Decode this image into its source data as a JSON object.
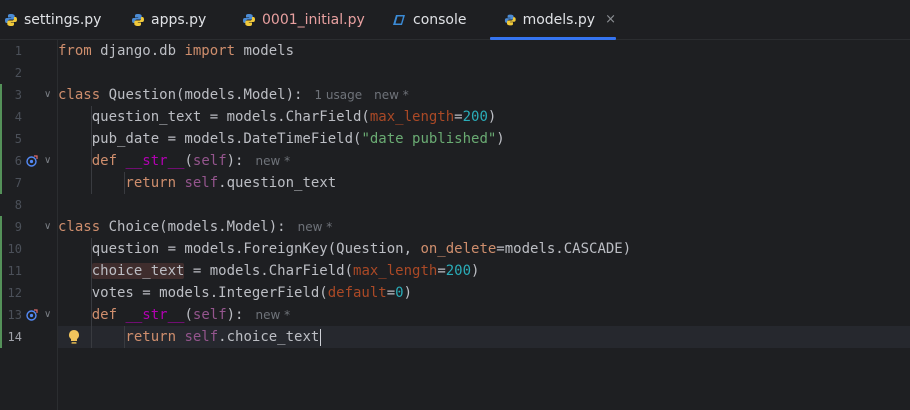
{
  "tabs": [
    {
      "label": "settings.py",
      "icon": "python-icon"
    },
    {
      "label": "apps.py",
      "icon": "python-icon"
    },
    {
      "label": "0001_initial.py",
      "icon": "python-icon"
    },
    {
      "label": "console",
      "icon": "console-icon"
    },
    {
      "label": "models.py",
      "icon": "python-icon",
      "active": true,
      "close": "×"
    }
  ],
  "hints": {
    "question_usage": "1 usage",
    "new": "new *"
  },
  "code": {
    "l1_from": "from",
    "l1_mod": " django.db ",
    "l1_import": "import",
    "l1_name": " models",
    "l3_class": "class",
    "l3_rest": " Question(models.Model):",
    "l4_a": "    question_text = models.CharField(",
    "l4_param": "max_length",
    "l4_eq": "=",
    "l4_num": "200",
    "l4_end": ")",
    "l5_a": "    pub_date = models.DateTimeField(",
    "l5_str": "\"date published\"",
    "l5_end": ")",
    "l6_def": "    def",
    "l6_sp": " ",
    "l6_dunder": "__str__",
    "l6_po": "(",
    "l6_self": "self",
    "l6_pc": "):",
    "l7_ret": "        return",
    "l7_sp": " ",
    "l7_self": "self",
    "l7_rest": ".question_text",
    "l9_class": "class",
    "l9_rest": " Choice(models.Model):",
    "l10_a": "    question = models.ForeignKey(Question, ",
    "l10_param": "on_delete",
    "l10_rest": "=models.CASCADE)",
    "l11_ind": "    ",
    "l11_hl": "choice_text",
    "l11_a": " = models.CharField(",
    "l11_param": "max_length",
    "l11_eq": "=",
    "l11_num": "200",
    "l11_end": ")",
    "l12_a": "    votes = models.IntegerField(",
    "l12_param": "default",
    "l12_eq": "=",
    "l12_num": "0",
    "l12_end": ")",
    "l13_def": "    def",
    "l13_sp": " ",
    "l13_dunder": "__str__",
    "l13_po": "(",
    "l13_self": "self",
    "l13_pc": "):",
    "l14_ret": "        return",
    "l14_sp": " ",
    "l14_self": "self",
    "l14_rest": ".choice_text"
  },
  "line_numbers": [
    "1",
    "2",
    "3",
    "4",
    "5",
    "6",
    "7",
    "8",
    "9",
    "10",
    "11",
    "12",
    "13",
    "14"
  ],
  "colors": {
    "background": "#1e1f22",
    "accent": "#3574f0",
    "keyword": "#cf8e6d",
    "string": "#6aab73",
    "number": "#2aacb8"
  }
}
